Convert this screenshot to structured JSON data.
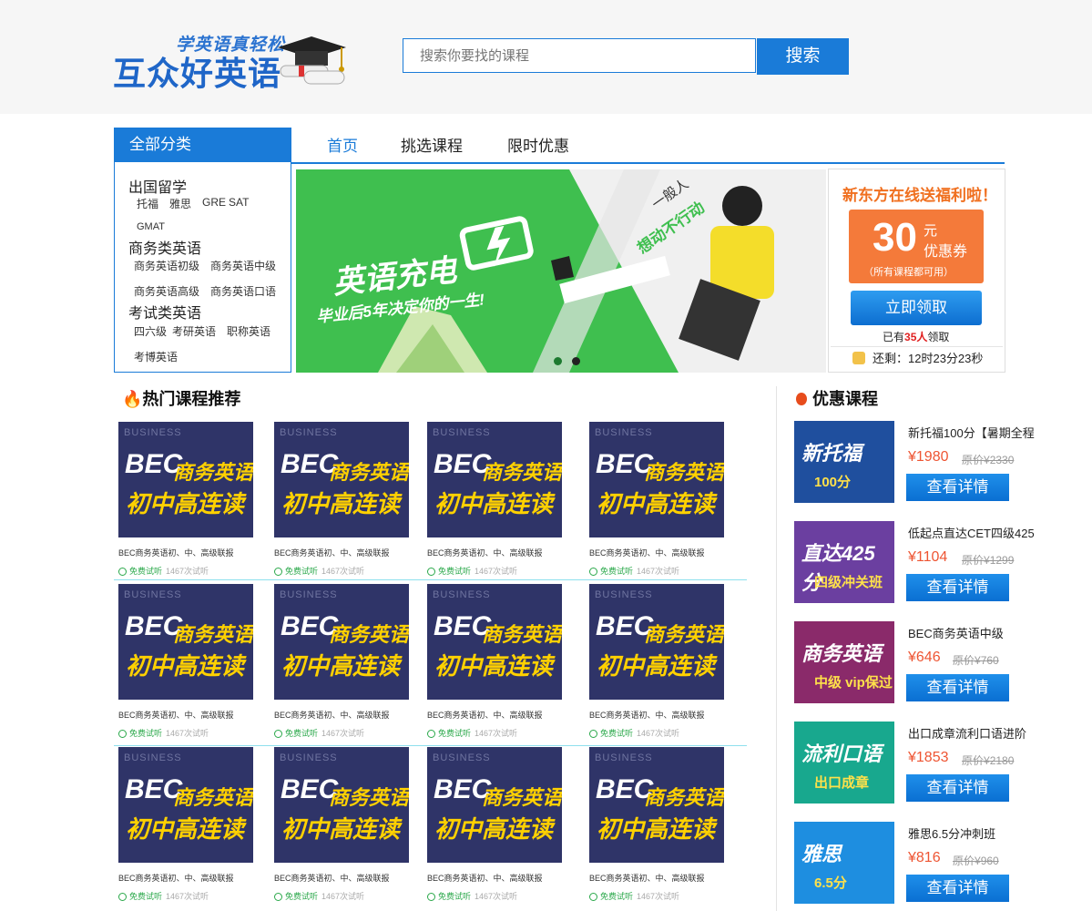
{
  "header": {
    "logo_sub": "学英语真轻松",
    "logo_main": "互众好英语",
    "search_placeholder": "搜索你要找的课程",
    "search_button": "搜索"
  },
  "categories": {
    "heading": "全部分类",
    "groups": [
      {
        "title": "出国留学",
        "links": [
          "托福",
          "雅思",
          "GRE",
          "SAT",
          "GMAT"
        ]
      },
      {
        "title": "商务类英语",
        "links": [
          "商务英语初级",
          "商务英语中级",
          "商务英语高级",
          "商务英语口语"
        ]
      },
      {
        "title": "考试类英语",
        "links": [
          "四六级",
          "考研英语",
          "职称英语",
          "考博英语"
        ]
      }
    ]
  },
  "nav": {
    "items": [
      "首页",
      "挑选课程",
      "限时优惠"
    ]
  },
  "banner": {
    "title": "英语充电",
    "subtitle": "毕业后5年决定你的一生!",
    "slogan_top": "一般人",
    "slogan": "想动不行动"
  },
  "promo": {
    "title": "新东方在线送福利啦！",
    "coupon_amount": "30",
    "coupon_unit": "元",
    "coupon_label": "优惠券",
    "coupon_note": "（所有课程都可用）",
    "claim_button": "立即领取",
    "claimed_prefix": "已有",
    "claimed_count": "35人",
    "claimed_suffix": "领取",
    "countdown": "还剩：12时23分23秒"
  },
  "hot": {
    "title": "热门课程推荐",
    "image_tag": "BUSINESS",
    "image_line1": "BEC商务英语",
    "image_line2": "初中高连读",
    "course_name": "BEC商务英语初、中、高级联报",
    "free_label": "免费试听",
    "trial_count": "1467次试听"
  },
  "discount": {
    "title": "优惠课程",
    "detail_button": "查看详情",
    "orig_prefix": "原价",
    "items": [
      {
        "name": "新托福100分【暑期全程",
        "price": "¥1980",
        "orig": "¥2330",
        "img_text": "新托福",
        "img_sub": "100分",
        "bg": "#1f4f9e"
      },
      {
        "name": "低起点直达CET四级425",
        "price": "¥1104",
        "orig": "¥1299",
        "img_text": "直达425分",
        "img_sub": "四级冲关班",
        "bg": "#6b3fa0"
      },
      {
        "name": "BEC商务英语中级",
        "price": "¥646",
        "orig": "¥760",
        "img_text": "商务英语",
        "img_sub": "中级 vip保过",
        "bg": "#8a2a6a"
      },
      {
        "name": "出口成章流利口语进阶",
        "price": "¥1853",
        "orig": "¥2180",
        "img_text": "流利口语",
        "img_sub": "出口成章",
        "bg": "#18a88e"
      },
      {
        "name": "雅思6.5分冲刺班",
        "price": "¥816",
        "orig": "¥960",
        "img_text": "雅思",
        "img_sub": "6.5分",
        "bg": "#1e8ee0"
      }
    ]
  },
  "colors": {
    "primary": "#1a7bd8",
    "orange": "#f47a3a",
    "price": "#ee5533",
    "banner_green": "#3fbf4f"
  }
}
